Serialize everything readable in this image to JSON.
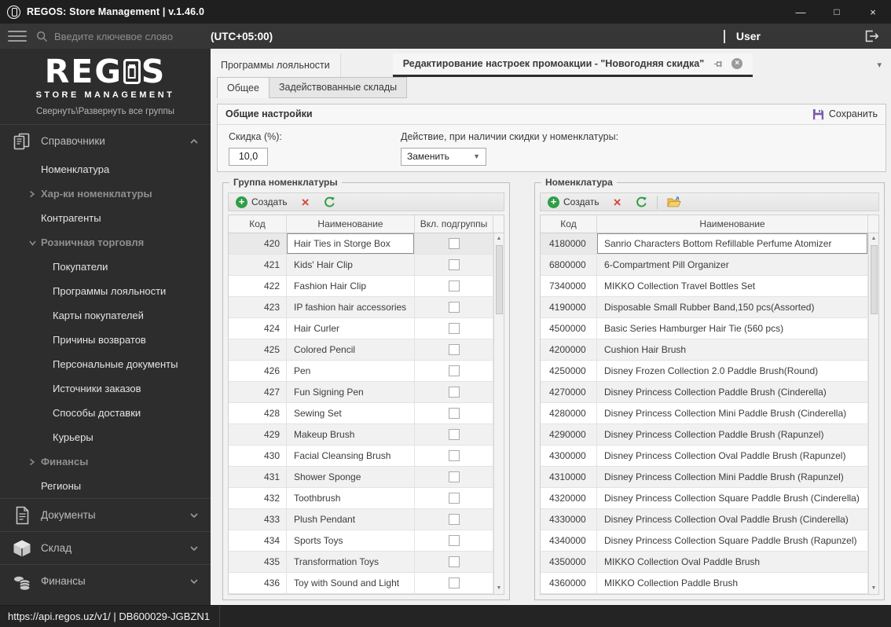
{
  "window": {
    "title": "REGOS: Store Management | v.1.46.0",
    "controls": {
      "minimize": "—",
      "maximize": "□",
      "close": "×"
    }
  },
  "header": {
    "search_placeholder": "Введите ключевое слово",
    "timezone": "(UTC+05:00)",
    "separator": "|",
    "user": "User"
  },
  "sidebar": {
    "logo_text": "REGOS",
    "logo_subtitle": "STORE MANAGEMENT",
    "collapse_toggle": "Свернуть\\Развернуть все группы",
    "groups": [
      {
        "label": "Справочники",
        "icon": "books-icon",
        "state": "expanded",
        "items": [
          {
            "label": "Номенклатура",
            "type": "item"
          },
          {
            "label": "Хар-ки номенклатуры",
            "type": "subgroup",
            "expanded": false
          },
          {
            "label": "Контрагенты",
            "type": "item"
          },
          {
            "label": "Розничная торговля",
            "type": "subgroup",
            "expanded": true
          },
          {
            "label": "Покупатели",
            "type": "subitem"
          },
          {
            "label": "Программы лояльности",
            "type": "subitem"
          },
          {
            "label": "Карты покупателей",
            "type": "subitem"
          },
          {
            "label": "Причины возвратов",
            "type": "subitem"
          },
          {
            "label": "Персональные документы",
            "type": "subitem"
          },
          {
            "label": "Источники заказов",
            "type": "subitem"
          },
          {
            "label": "Способы доставки",
            "type": "subitem"
          },
          {
            "label": "Курьеры",
            "type": "subitem"
          },
          {
            "label": "Финансы",
            "type": "subgroup",
            "expanded": false
          },
          {
            "label": "Регионы",
            "type": "item"
          }
        ]
      },
      {
        "label": "Документы",
        "icon": "document-icon",
        "state": "collapsed",
        "items": []
      },
      {
        "label": "Склад",
        "icon": "box-icon",
        "state": "collapsed",
        "items": []
      },
      {
        "label": "Финансы",
        "icon": "coins-icon",
        "state": "collapsed",
        "items": []
      }
    ]
  },
  "status_bar": {
    "text": "https://api.regos.uz/v1/ | DB600029-JGBZN1"
  },
  "tabs": {
    "document": [
      {
        "label": "Программы лояльности",
        "active": false
      },
      {
        "label": "Редактирование настроек промоакции - \"Новогодняя скидка\"",
        "active": true
      }
    ],
    "sub": [
      {
        "label": "Общее",
        "active": true
      },
      {
        "label": "Задействованные склады",
        "active": false
      }
    ]
  },
  "settings": {
    "title": "Общие настройки",
    "save_label": "Сохранить",
    "discount": {
      "label": "Скидка (%):",
      "value": "10,0"
    },
    "action": {
      "label": "Действие, при наличии скидки у номенклатуры:",
      "value": "Заменить"
    }
  },
  "group_table": {
    "legend": "Группа номенклатуры",
    "toolbar": {
      "create_label": "Создать"
    },
    "columns": [
      "Код",
      "Наименование",
      "Вкл. подгруппы"
    ],
    "selected_code": "420",
    "rows": [
      {
        "code": "420",
        "name": "Hair Ties in Storge Box",
        "checked": false
      },
      {
        "code": "421",
        "name": "Kids' Hair Clip",
        "checked": false
      },
      {
        "code": "422",
        "name": "Fashion Hair Clip",
        "checked": false
      },
      {
        "code": "423",
        "name": "IP fashion hair accessories",
        "checked": false
      },
      {
        "code": "424",
        "name": "Hair Curler",
        "checked": false
      },
      {
        "code": "425",
        "name": "Colored Pencil",
        "checked": false
      },
      {
        "code": "426",
        "name": "Pen",
        "checked": false
      },
      {
        "code": "427",
        "name": "Fun Signing Pen",
        "checked": false
      },
      {
        "code": "428",
        "name": "Sewing Set",
        "checked": false
      },
      {
        "code": "429",
        "name": "Makeup Brush",
        "checked": false
      },
      {
        "code": "430",
        "name": "Facial Cleansing Brush",
        "checked": false
      },
      {
        "code": "431",
        "name": "Shower Sponge",
        "checked": false
      },
      {
        "code": "432",
        "name": "Toothbrush",
        "checked": false
      },
      {
        "code": "433",
        "name": "Plush Pendant",
        "checked": false
      },
      {
        "code": "434",
        "name": "Sports Toys",
        "checked": false
      },
      {
        "code": "435",
        "name": "Transformation Toys",
        "checked": false
      },
      {
        "code": "436",
        "name": "Toy with Sound and Light",
        "checked": false
      }
    ]
  },
  "item_table": {
    "legend": "Номенклатура",
    "toolbar": {
      "create_label": "Создать"
    },
    "columns": [
      "Код",
      "Наименование"
    ],
    "selected_code": "4180000",
    "rows": [
      {
        "code": "4180000",
        "name": "Sanrio Characters Bottom Refillable Perfume Atomizer"
      },
      {
        "code": "6800000",
        "name": "6-Compartment Pill Organizer"
      },
      {
        "code": "7340000",
        "name": "MIKKO Collection Travel Bottles Set"
      },
      {
        "code": "4190000",
        "name": "Disposable Small Rubber Band,150 pcs(Assorted)"
      },
      {
        "code": "4500000",
        "name": "Basic Series Hamburger Hair Tie (560 pcs)"
      },
      {
        "code": "4200000",
        "name": "Cushion Hair Brush"
      },
      {
        "code": "4250000",
        "name": "Disney Frozen Collection 2.0 Paddle Brush(Round)"
      },
      {
        "code": "4270000",
        "name": "Disney Princess Collection Paddle Brush (Cinderella)"
      },
      {
        "code": "4280000",
        "name": "Disney Princess Collection Mini Paddle Brush (Cinderella)"
      },
      {
        "code": "4290000",
        "name": "Disney Princess Collection Paddle Brush (Rapunzel)"
      },
      {
        "code": "4300000",
        "name": "Disney Princess Collection Oval Paddle Brush (Rapunzel)"
      },
      {
        "code": "4310000",
        "name": "Disney Princess Collection Mini Paddle Brush (Rapunzel)"
      },
      {
        "code": "4320000",
        "name": "Disney Princess Collection Square Paddle Brush (Cinderella)"
      },
      {
        "code": "4330000",
        "name": "Disney Princess Collection Oval Paddle Brush (Cinderella)"
      },
      {
        "code": "4340000",
        "name": "Disney Princess Collection Square Paddle Brush (Rapunzel)"
      },
      {
        "code": "4350000",
        "name": "MIKKO Collection Oval Paddle Brush"
      },
      {
        "code": "4360000",
        "name": "MIKKO Collection Paddle Brush"
      }
    ]
  },
  "colors": {
    "accent_green": "#2f9e44",
    "accent_red": "#d9453c",
    "accent_purple": "#7e5aa8",
    "folder_yellow": "#f0c24b",
    "dark_bg": "#2d2d2d",
    "titlebar_bg": "#1f1f1f"
  }
}
